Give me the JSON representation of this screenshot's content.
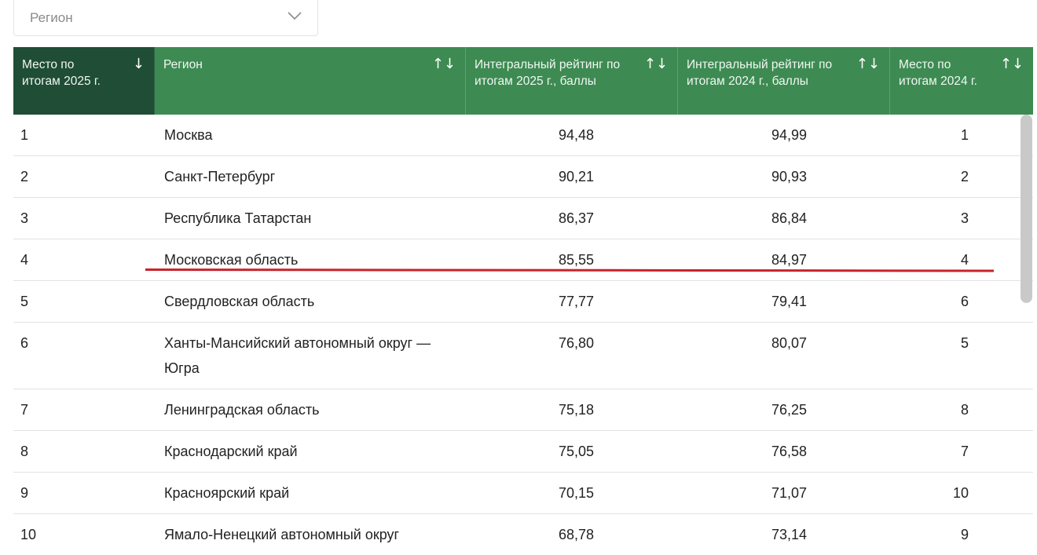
{
  "filter": {
    "placeholder": "Регион",
    "icon": "chevron-down-icon"
  },
  "colors": {
    "header_bg": "#3d8b52",
    "header_active_bg": "#1f4d36",
    "highlight_line": "#c8232a"
  },
  "table": {
    "columns": [
      {
        "label": "Место по итогам 2025 г.",
        "sort_icon": "↓",
        "active": true
      },
      {
        "label": "Регион",
        "sort_icon": "↑↓",
        "active": false
      },
      {
        "label": "Интегральный рейтинг по итогам 2025 г., баллы",
        "sort_icon": "↑↓",
        "active": false
      },
      {
        "label": "Интегральный рейтинг по итогам 2024 г., баллы",
        "sort_icon": "↑↓",
        "active": false
      },
      {
        "label": "Место по итогам 2024 г.",
        "sort_icon": "↑↓",
        "active": false
      }
    ],
    "rows": [
      {
        "place_2025": "1",
        "region": "Москва",
        "rating_2025": "94,48",
        "rating_2024": "94,99",
        "place_2024": "1"
      },
      {
        "place_2025": "2",
        "region": "Санкт-Петербург",
        "rating_2025": "90,21",
        "rating_2024": "90,93",
        "place_2024": "2"
      },
      {
        "place_2025": "3",
        "region": "Республика Татарстан",
        "rating_2025": "86,37",
        "rating_2024": "86,84",
        "place_2024": "3"
      },
      {
        "place_2025": "4",
        "region": "Московская область",
        "rating_2025": "85,55",
        "rating_2024": "84,97",
        "place_2024": "4"
      },
      {
        "place_2025": "5",
        "region": "Свердловская область",
        "rating_2025": "77,77",
        "rating_2024": "79,41",
        "place_2024": "6"
      },
      {
        "place_2025": "6",
        "region": "Ханты-Мансийский автономный округ — Югра",
        "rating_2025": "76,80",
        "rating_2024": "80,07",
        "place_2024": "5"
      },
      {
        "place_2025": "7",
        "region": "Ленинградская область",
        "rating_2025": "75,18",
        "rating_2024": "76,25",
        "place_2024": "8"
      },
      {
        "place_2025": "8",
        "region": "Краснодарский край",
        "rating_2025": "75,05",
        "rating_2024": "76,58",
        "place_2024": "7"
      },
      {
        "place_2025": "9",
        "region": "Красноярский край",
        "rating_2025": "70,15",
        "rating_2024": "71,07",
        "place_2024": "10"
      },
      {
        "place_2025": "10",
        "region": "Ямало-Ненецкий автономный округ",
        "rating_2025": "68,78",
        "rating_2024": "73,14",
        "place_2024": "9"
      }
    ]
  }
}
